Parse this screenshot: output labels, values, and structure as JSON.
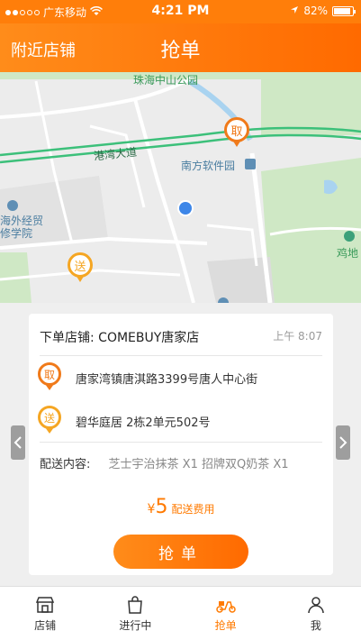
{
  "status_bar": {
    "carrier": "广东移动",
    "time": "4:21 PM",
    "battery": "82%"
  },
  "nav": {
    "left_link": "附近店铺",
    "title": "抢单"
  },
  "map": {
    "labels": {
      "park": "珠海中山公园",
      "road": "港湾大道",
      "software_park": "南方软件园",
      "college_1": "海外经贸",
      "college_2": "修学院",
      "right": "鸡地"
    },
    "pickup_pin": "取",
    "delivery_pin": "送"
  },
  "order": {
    "store_label": "下单店铺: COMEBUY唐家店",
    "time": "上午 8:07",
    "pickup_icon": "取",
    "pickup_address": "唐家湾镇唐淇路3399号唐人中心街",
    "delivery_icon": "送",
    "delivery_address": "碧华庭居 2栋2单元502号",
    "content_label": "配送内容:",
    "content_items": "芝士宇治抹茶 X1   招牌双Q奶茶 X1",
    "fee_currency": "¥",
    "fee_amount": "5",
    "fee_label": "配送费用",
    "grab_button": "抢单"
  },
  "tabs": [
    {
      "label": "店铺",
      "icon": "store-icon"
    },
    {
      "label": "进行中",
      "icon": "bag-icon"
    },
    {
      "label": "抢单",
      "icon": "scooter-icon"
    },
    {
      "label": "我",
      "icon": "user-icon"
    }
  ],
  "colors": {
    "brand": "#ff7a00",
    "pickup_pin": "#f07a1a",
    "delivery_pin": "#f5a623",
    "road": "#3cc07a"
  }
}
